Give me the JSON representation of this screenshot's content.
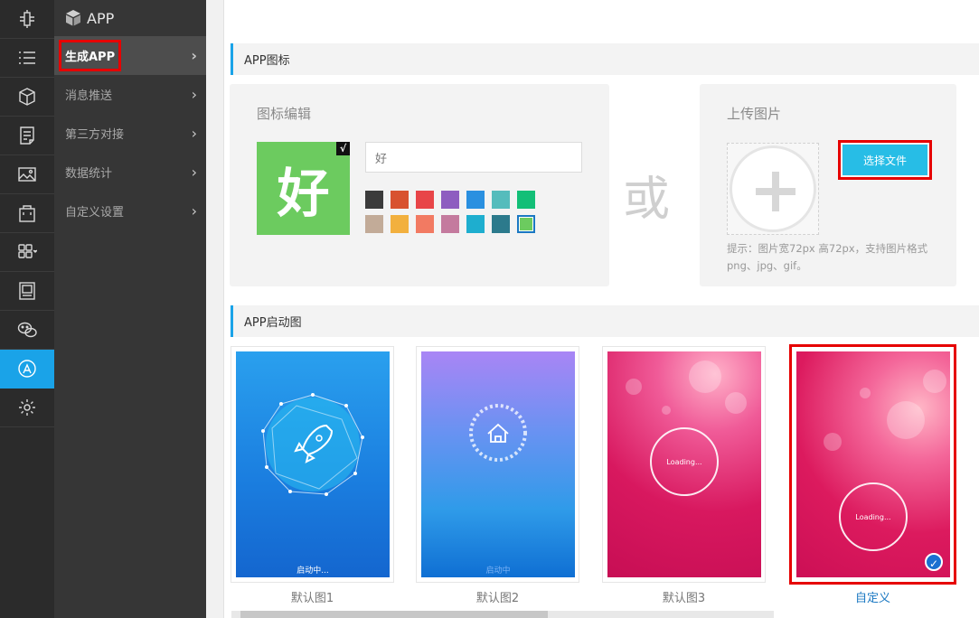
{
  "rail": {
    "items": [
      {
        "icon": "plugin-icon"
      },
      {
        "icon": "list-icon"
      },
      {
        "icon": "cube-icon"
      },
      {
        "icon": "document-icon"
      },
      {
        "icon": "image-icon"
      },
      {
        "icon": "bag-icon"
      },
      {
        "icon": "grid-icon"
      },
      {
        "icon": "picture-frame-icon"
      },
      {
        "icon": "wechat-icon"
      },
      {
        "icon": "app-store-icon"
      },
      {
        "icon": "settings-icon"
      }
    ]
  },
  "subnav": {
    "title": "APP",
    "items": [
      {
        "label": "生成APP",
        "active": true
      },
      {
        "label": "消息推送"
      },
      {
        "label": "第三方对接"
      },
      {
        "label": "数据统计"
      },
      {
        "label": "自定义设置"
      }
    ]
  },
  "icon_section": {
    "title": "APP图标",
    "editor": {
      "title": "图标编辑",
      "preview_char": "好",
      "preview_check": "√",
      "input_value": "好",
      "colors": [
        "#3b3b3b",
        "#d8522f",
        "#e84548",
        "#8e5dc0",
        "#2a90e0",
        "#55bcbc",
        "#13bf77",
        "#c2ab98",
        "#f2b03e",
        "#f27a62",
        "#c47a9e",
        "#1eaecf",
        "#2c7a8c",
        "#6ccb5f"
      ],
      "selected_color": "#6ccb5f"
    },
    "or_text": "或",
    "upload": {
      "title": "上传图片",
      "button_label": "选择文件",
      "hint": "提示：图片宽72px 高72px，支持图片格式png、jpg、gif。"
    }
  },
  "splash_section": {
    "title": "APP启动图",
    "items": [
      {
        "caption": "默认图1",
        "image_text": "启动中..."
      },
      {
        "caption": "默认图2",
        "image_text": "启动中"
      },
      {
        "caption": "默认图3",
        "image_text": "Loading..."
      },
      {
        "caption": "自定义",
        "image_text": "Loading...",
        "selected": true
      }
    ]
  }
}
